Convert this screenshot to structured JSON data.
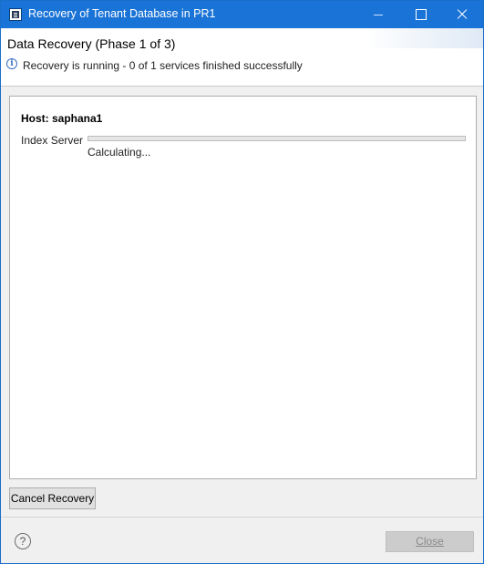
{
  "window": {
    "title": "Recovery of Tenant Database in PR1",
    "icons": {
      "app": "database-app-icon",
      "minimize": "minimize-icon",
      "maximize": "maximize-icon",
      "close": "close-icon"
    },
    "colors": {
      "titlebar": "#1a73d6"
    }
  },
  "header": {
    "phase_title": "Data Recovery (Phase 1 of 3)",
    "status_icon": "info-icon",
    "status_text": "Recovery is running - 0 of 1 services finished successfully"
  },
  "main": {
    "host_label": "Host: saphana1",
    "services": [
      {
        "name": "Index Server",
        "progress": 0,
        "status": "Calculating..."
      }
    ]
  },
  "buttons": {
    "cancel_label": "Cancel Recovery",
    "close_label": "Close",
    "close_enabled": false
  },
  "footer": {
    "help_icon": "help-icon",
    "help_glyph": "?"
  }
}
